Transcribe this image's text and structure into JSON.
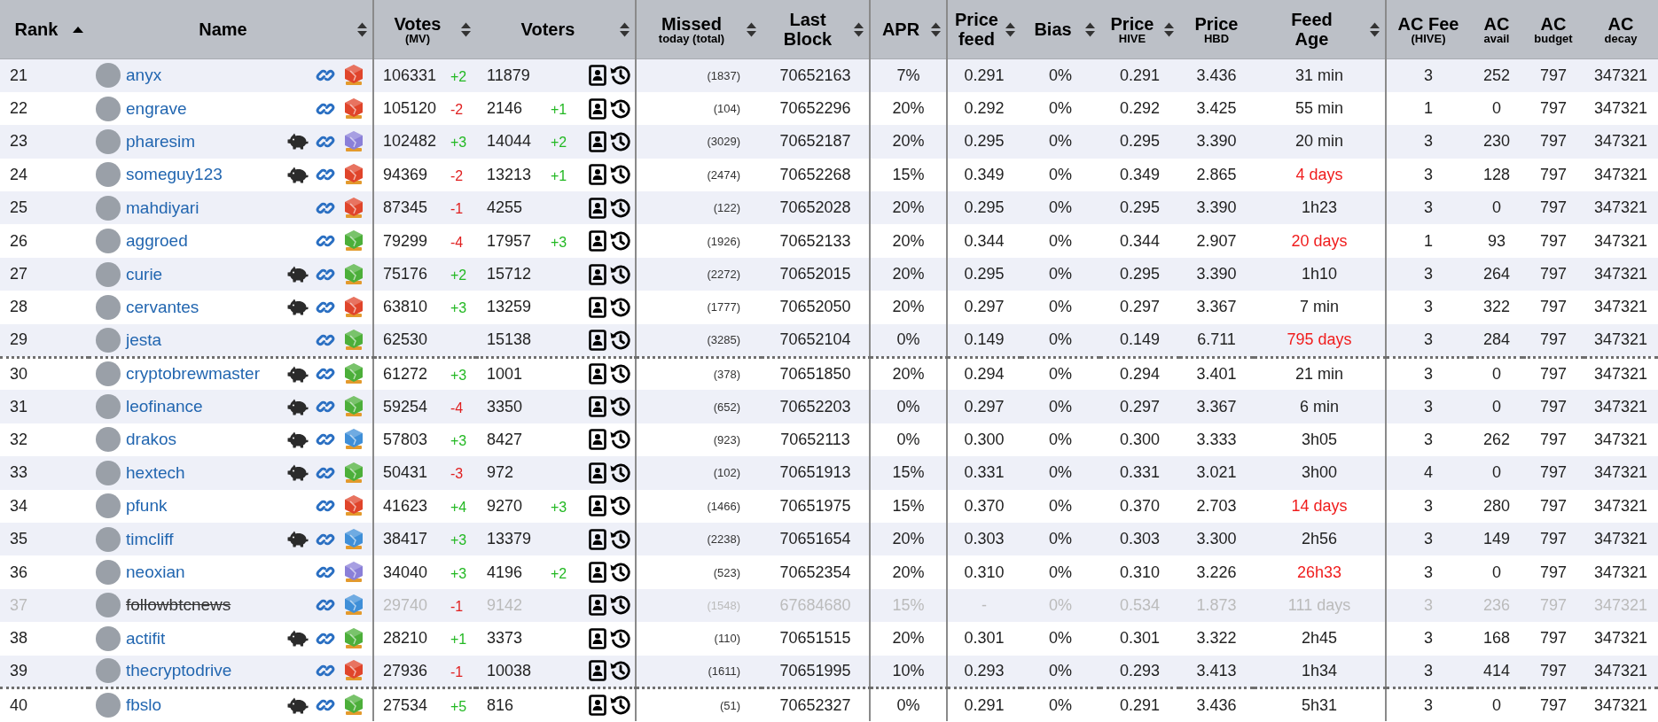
{
  "columns": [
    {
      "label": "Rank",
      "sortable": true,
      "sorted": true
    },
    {
      "label": "Name",
      "sortable": true,
      "sorted": false
    },
    {
      "label": "Votes",
      "sub": "(MV)",
      "sortable": true,
      "sorted": false
    },
    {
      "label": "Voters",
      "sortable": true,
      "sorted": false
    },
    {
      "label": "Missed",
      "sub": "today (total)",
      "sortable": true,
      "sorted": false
    },
    {
      "label": "Last Block",
      "sortable": true,
      "sorted": false
    },
    {
      "label": "APR",
      "sortable": true,
      "sorted": false
    },
    {
      "label": "Price feed",
      "sortable": true,
      "sorted": false
    },
    {
      "label": "Bias",
      "sortable": true,
      "sorted": false
    },
    {
      "label": "Price",
      "sub": "HIVE",
      "sortable": true,
      "sorted": false
    },
    {
      "label": "Price",
      "sub": "HBD",
      "sortable": false,
      "sorted": false
    },
    {
      "label": "Feed Age",
      "sortable": true,
      "sorted": false
    },
    {
      "label": "AC Fee",
      "sub": "(HIVE)",
      "sortable": false,
      "sorted": false
    },
    {
      "label": "AC",
      "sub": "avail",
      "sortable": false,
      "sorted": false
    },
    {
      "label": "AC",
      "sub": "budget",
      "sortable": false,
      "sorted": false
    },
    {
      "label": "AC",
      "sub": "decay",
      "sortable": false,
      "sorted": false
    }
  ],
  "rows": [
    {
      "rank": "21",
      "name": "anyx",
      "piggy": false,
      "color": "#e0452b",
      "votes": "106331",
      "votes_change": {
        "text": "+2",
        "rising": true
      },
      "voters": "11879",
      "missed": "(1837)",
      "last_block": "70652163",
      "apr": "7%",
      "price_feed": "0.291",
      "bias": "0%",
      "price_hive": "0.291",
      "price_hbd": "3.436",
      "feed_age": "31 min",
      "stale": false,
      "ac_fee": "3",
      "ac_avail": "252",
      "ac_budget": "797",
      "ac_decay": "347321",
      "disabled": false,
      "group_start": false
    },
    {
      "rank": "22",
      "name": "engrave",
      "piggy": false,
      "color": "#e0452b",
      "votes": "105120",
      "votes_change": {
        "text": "-2",
        "rising": false
      },
      "voters": "2146",
      "voters_change": "+1",
      "missed": "(104)",
      "last_block": "70652296",
      "apr": "20%",
      "price_feed": "0.292",
      "bias": "0%",
      "price_hive": "0.292",
      "price_hbd": "3.425",
      "feed_age": "55 min",
      "stale": false,
      "ac_fee": "1",
      "ac_avail": "0",
      "ac_budget": "797",
      "ac_decay": "347321",
      "disabled": false,
      "group_start": false
    },
    {
      "rank": "23",
      "name": "pharesim",
      "piggy": true,
      "color": "#8a7fd8",
      "votes": "102482",
      "votes_change": {
        "text": "+3",
        "rising": true
      },
      "voters": "14044",
      "voters_change": "+2",
      "missed": "(3029)",
      "last_block": "70652187",
      "apr": "20%",
      "price_feed": "0.295",
      "bias": "0%",
      "price_hive": "0.295",
      "price_hbd": "3.390",
      "feed_age": "20 min",
      "stale": false,
      "ac_fee": "3",
      "ac_avail": "230",
      "ac_budget": "797",
      "ac_decay": "347321",
      "disabled": false,
      "group_start": false
    },
    {
      "rank": "24",
      "name": "someguy123",
      "piggy": true,
      "color": "#e0452b",
      "votes": "94369",
      "votes_change": {
        "text": "-2",
        "rising": false
      },
      "voters": "13213",
      "voters_change": "+1",
      "missed": "(2474)",
      "last_block": "70652268",
      "apr": "15%",
      "price_feed": "0.349",
      "bias": "0%",
      "price_hive": "0.349",
      "price_hbd": "2.865",
      "feed_age": "4 days",
      "stale": true,
      "ac_fee": "3",
      "ac_avail": "128",
      "ac_budget": "797",
      "ac_decay": "347321",
      "disabled": false,
      "group_start": false
    },
    {
      "rank": "25",
      "name": "mahdiyari",
      "piggy": false,
      "color": "#e0452b",
      "votes": "87345",
      "votes_change": {
        "text": "-1",
        "rising": false
      },
      "voters": "4255",
      "missed": "(122)",
      "last_block": "70652028",
      "apr": "20%",
      "price_feed": "0.295",
      "bias": "0%",
      "price_hive": "0.295",
      "price_hbd": "3.390",
      "feed_age": "1h23",
      "stale": false,
      "ac_fee": "3",
      "ac_avail": "0",
      "ac_budget": "797",
      "ac_decay": "347321",
      "disabled": false,
      "group_start": false
    },
    {
      "rank": "26",
      "name": "aggroed",
      "piggy": false,
      "color": "#4caf3a",
      "votes": "79299",
      "votes_change": {
        "text": "-4",
        "rising": false
      },
      "voters": "17957",
      "voters_change": "+3",
      "missed": "(1926)",
      "last_block": "70652133",
      "apr": "20%",
      "price_feed": "0.344",
      "bias": "0%",
      "price_hive": "0.344",
      "price_hbd": "2.907",
      "feed_age": "20 days",
      "stale": true,
      "ac_fee": "1",
      "ac_avail": "93",
      "ac_budget": "797",
      "ac_decay": "347321",
      "disabled": false,
      "group_start": false
    },
    {
      "rank": "27",
      "name": "curie",
      "piggy": true,
      "color": "#4caf3a",
      "votes": "75176",
      "votes_change": {
        "text": "+2",
        "rising": true
      },
      "voters": "15712",
      "missed": "(2272)",
      "last_block": "70652015",
      "apr": "20%",
      "price_feed": "0.295",
      "bias": "0%",
      "price_hive": "0.295",
      "price_hbd": "3.390",
      "feed_age": "1h10",
      "stale": false,
      "ac_fee": "3",
      "ac_avail": "264",
      "ac_budget": "797",
      "ac_decay": "347321",
      "disabled": false,
      "group_start": false
    },
    {
      "rank": "28",
      "name": "cervantes",
      "piggy": true,
      "color": "#e0452b",
      "votes": "63810",
      "votes_change": {
        "text": "+3",
        "rising": true
      },
      "voters": "13259",
      "missed": "(1777)",
      "last_block": "70652050",
      "apr": "20%",
      "price_feed": "0.297",
      "bias": "0%",
      "price_hive": "0.297",
      "price_hbd": "3.367",
      "feed_age": "7 min",
      "stale": false,
      "ac_fee": "3",
      "ac_avail": "322",
      "ac_budget": "797",
      "ac_decay": "347321",
      "disabled": false,
      "group_start": false
    },
    {
      "rank": "29",
      "name": "jesta",
      "piggy": false,
      "color": "#4caf3a",
      "votes": "62530",
      "voters": "15138",
      "missed": "(3285)",
      "last_block": "70652104",
      "apr": "0%",
      "price_feed": "0.149",
      "bias": "0%",
      "price_hive": "0.149",
      "price_hbd": "6.711",
      "feed_age": "795 days",
      "stale": true,
      "ac_fee": "3",
      "ac_avail": "284",
      "ac_budget": "797",
      "ac_decay": "347321",
      "disabled": false,
      "group_start": false
    },
    {
      "rank": "30",
      "name": "cryptobrewmaster",
      "piggy": true,
      "color": "#4caf3a",
      "votes": "61272",
      "votes_change": {
        "text": "+3",
        "rising": true
      },
      "voters": "1001",
      "missed": "(378)",
      "last_block": "70651850",
      "apr": "20%",
      "price_feed": "0.294",
      "bias": "0%",
      "price_hive": "0.294",
      "price_hbd": "3.401",
      "feed_age": "21 min",
      "stale": false,
      "ac_fee": "3",
      "ac_avail": "0",
      "ac_budget": "797",
      "ac_decay": "347321",
      "disabled": false,
      "group_start": true
    },
    {
      "rank": "31",
      "name": "leofinance",
      "piggy": true,
      "color": "#4caf3a",
      "votes": "59254",
      "votes_change": {
        "text": "-4",
        "rising": false
      },
      "voters": "3350",
      "missed": "(652)",
      "last_block": "70652203",
      "apr": "0%",
      "price_feed": "0.297",
      "bias": "0%",
      "price_hive": "0.297",
      "price_hbd": "3.367",
      "feed_age": "6 min",
      "stale": false,
      "ac_fee": "3",
      "ac_avail": "0",
      "ac_budget": "797",
      "ac_decay": "347321",
      "disabled": false,
      "group_start": false
    },
    {
      "rank": "32",
      "name": "drakos",
      "piggy": true,
      "color": "#3f8fd8",
      "votes": "57803",
      "votes_change": {
        "text": "+3",
        "rising": true
      },
      "voters": "8427",
      "missed": "(923)",
      "last_block": "70652113",
      "apr": "0%",
      "price_feed": "0.300",
      "bias": "0%",
      "price_hive": "0.300",
      "price_hbd": "3.333",
      "feed_age": "3h05",
      "stale": false,
      "ac_fee": "3",
      "ac_avail": "262",
      "ac_budget": "797",
      "ac_decay": "347321",
      "disabled": false,
      "group_start": false
    },
    {
      "rank": "33",
      "name": "hextech",
      "piggy": true,
      "color": "#4caf3a",
      "votes": "50431",
      "votes_change": {
        "text": "-3",
        "rising": false
      },
      "voters": "972",
      "missed": "(102)",
      "last_block": "70651913",
      "apr": "15%",
      "price_feed": "0.331",
      "bias": "0%",
      "price_hive": "0.331",
      "price_hbd": "3.021",
      "feed_age": "3h00",
      "stale": false,
      "ac_fee": "4",
      "ac_avail": "0",
      "ac_budget": "797",
      "ac_decay": "347321",
      "disabled": false,
      "group_start": false
    },
    {
      "rank": "34",
      "name": "pfunk",
      "piggy": false,
      "color": "#e0452b",
      "votes": "41623",
      "votes_change": {
        "text": "+4",
        "rising": true
      },
      "voters": "9270",
      "voters_change": "+3",
      "missed": "(1466)",
      "last_block": "70651975",
      "apr": "15%",
      "price_feed": "0.370",
      "bias": "0%",
      "price_hive": "0.370",
      "price_hbd": "2.703",
      "feed_age": "14 days",
      "stale": true,
      "ac_fee": "3",
      "ac_avail": "280",
      "ac_budget": "797",
      "ac_decay": "347321",
      "disabled": false,
      "group_start": false
    },
    {
      "rank": "35",
      "name": "timcliff",
      "piggy": true,
      "color": "#3f8fd8",
      "votes": "38417",
      "votes_change": {
        "text": "+3",
        "rising": true
      },
      "voters": "13379",
      "missed": "(2238)",
      "last_block": "70651654",
      "apr": "20%",
      "price_feed": "0.303",
      "bias": "0%",
      "price_hive": "0.303",
      "price_hbd": "3.300",
      "feed_age": "2h56",
      "stale": false,
      "ac_fee": "3",
      "ac_avail": "149",
      "ac_budget": "797",
      "ac_decay": "347321",
      "disabled": false,
      "group_start": false
    },
    {
      "rank": "36",
      "name": "neoxian",
      "piggy": false,
      "color": "#8a7fd8",
      "votes": "34040",
      "votes_change": {
        "text": "+3",
        "rising": true
      },
      "voters": "4196",
      "voters_change": "+2",
      "missed": "(523)",
      "last_block": "70652354",
      "apr": "20%",
      "price_feed": "0.310",
      "bias": "0%",
      "price_hive": "0.310",
      "price_hbd": "3.226",
      "feed_age": "26h33",
      "stale": true,
      "ac_fee": "3",
      "ac_avail": "0",
      "ac_budget": "797",
      "ac_decay": "347321",
      "disabled": false,
      "group_start": false
    },
    {
      "rank": "37",
      "name": "followbtcnews",
      "piggy": false,
      "color": "#3f8fd8",
      "votes": "29740",
      "votes_change": {
        "text": "-1",
        "rising": false
      },
      "voters": "9142",
      "missed": "(1548)",
      "last_block": "67684680",
      "apr": "15%",
      "price_feed": "-",
      "bias": "0%",
      "price_hive": "0.534",
      "price_hbd": "1.873",
      "feed_age": "111 days",
      "stale": false,
      "ac_fee": "3",
      "ac_avail": "236",
      "ac_budget": "797",
      "ac_decay": "347321",
      "disabled": true,
      "group_start": false
    },
    {
      "rank": "38",
      "name": "actifit",
      "piggy": true,
      "color": "#4caf3a",
      "votes": "28210",
      "votes_change": {
        "text": "+1",
        "rising": true
      },
      "voters": "3373",
      "missed": "(110)",
      "last_block": "70651515",
      "apr": "20%",
      "price_feed": "0.301",
      "bias": "0%",
      "price_hive": "0.301",
      "price_hbd": "3.322",
      "feed_age": "2h45",
      "stale": false,
      "ac_fee": "3",
      "ac_avail": "168",
      "ac_budget": "797",
      "ac_decay": "347321",
      "disabled": false,
      "group_start": false
    },
    {
      "rank": "39",
      "name": "thecryptodrive",
      "piggy": false,
      "color": "#e0452b",
      "votes": "27936",
      "votes_change": {
        "text": "-1",
        "rising": false
      },
      "voters": "10038",
      "missed": "(1611)",
      "last_block": "70651995",
      "apr": "10%",
      "price_feed": "0.293",
      "bias": "0%",
      "price_hive": "0.293",
      "price_hbd": "3.413",
      "feed_age": "1h34",
      "stale": false,
      "ac_fee": "3",
      "ac_avail": "414",
      "ac_budget": "797",
      "ac_decay": "347321",
      "disabled": false,
      "group_start": false
    },
    {
      "rank": "40",
      "name": "fbslo",
      "piggy": true,
      "color": "#4caf3a",
      "votes": "27534",
      "votes_change": {
        "text": "+5",
        "rising": true
      },
      "voters": "816",
      "missed": "(51)",
      "last_block": "70652327",
      "apr": "0%",
      "price_feed": "0.291",
      "bias": "0%",
      "price_hive": "0.291",
      "price_hbd": "3.436",
      "feed_age": "5h31",
      "stale": false,
      "ac_fee": "3",
      "ac_avail": "0",
      "ac_budget": "797",
      "ac_decay": "347321",
      "disabled": false,
      "group_start": true
    }
  ]
}
